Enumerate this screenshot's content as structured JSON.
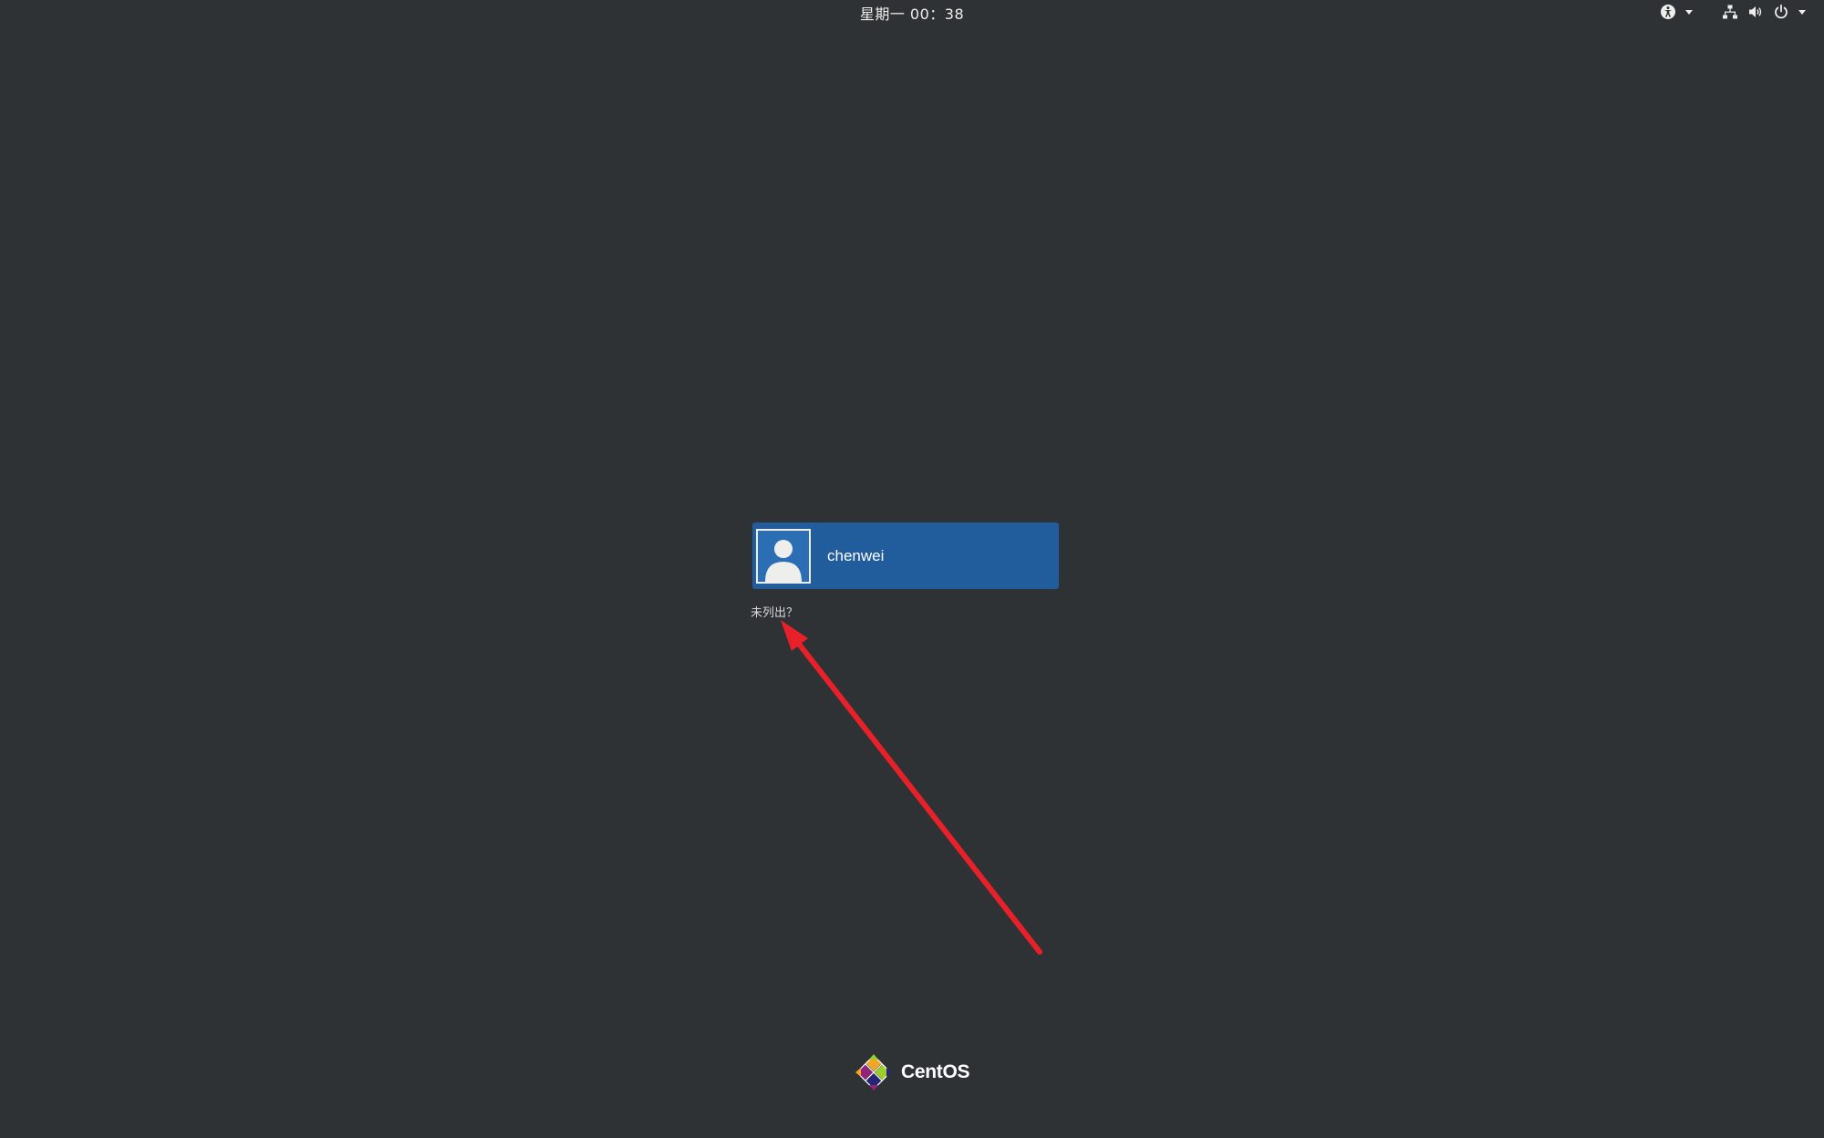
{
  "top_bar": {
    "clock": "星期一  00：38",
    "icons": [
      "accessibility-icon",
      "network-icon",
      "volume-icon",
      "power-icon"
    ]
  },
  "users": [
    {
      "name": "chenwei",
      "avatar": "user-avatar-icon"
    }
  ],
  "not_listed": "未列出？",
  "logo": {
    "text": "CentOS"
  },
  "colors": {
    "background": "#2e3235",
    "selected_user": "#215d9c",
    "annotation_arrow": "#e8202a"
  }
}
